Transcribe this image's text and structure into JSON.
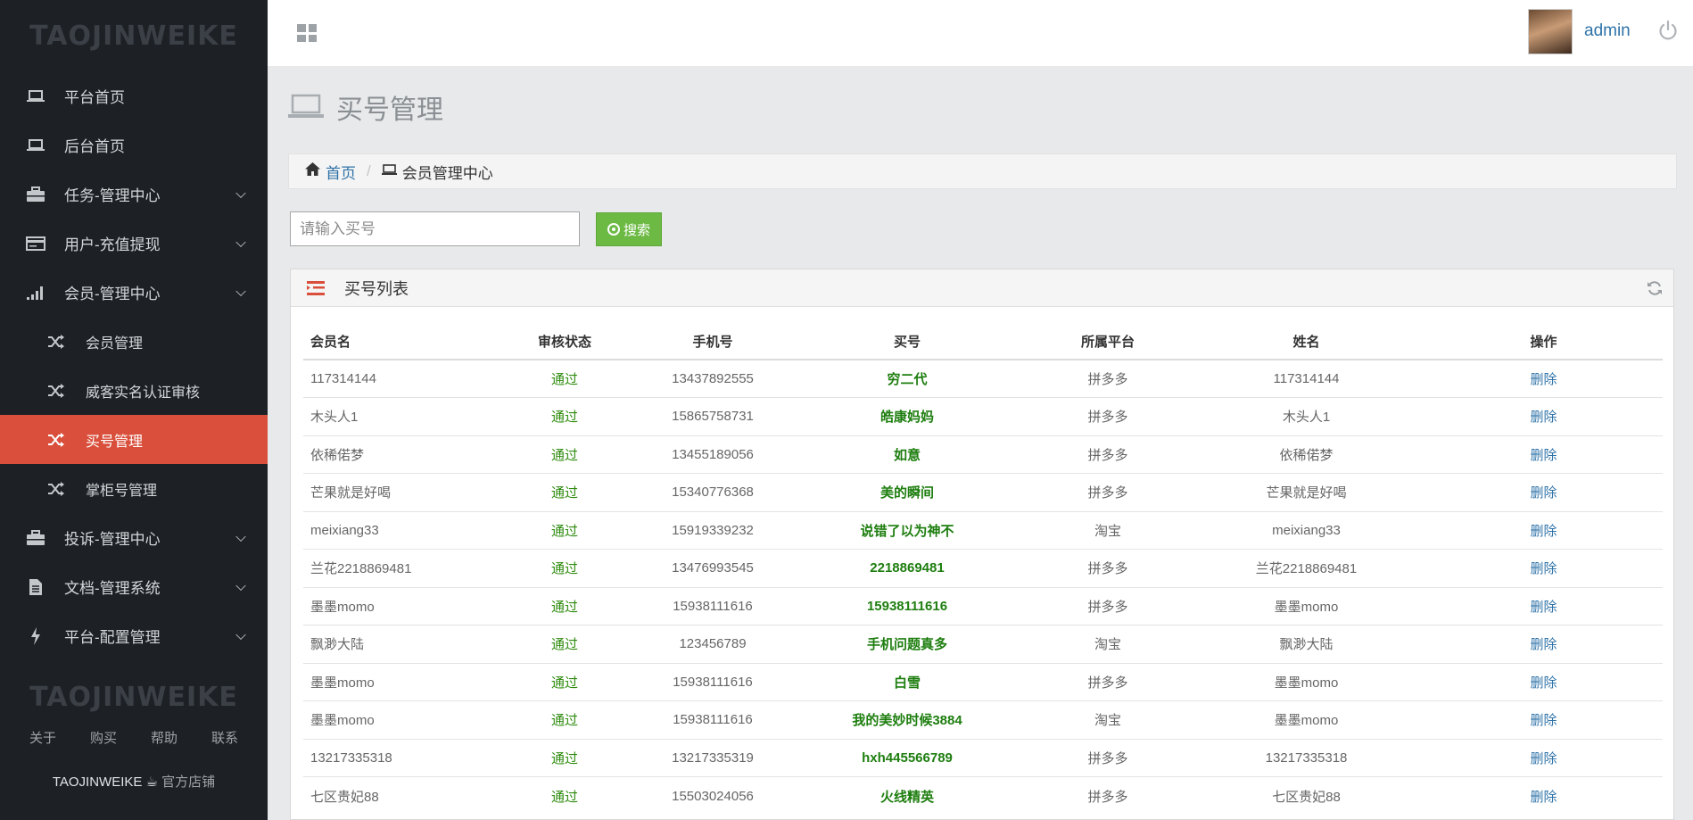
{
  "app": {
    "brand": "TAOJINWEIKE",
    "user": "admin"
  },
  "sidebar": {
    "items": [
      {
        "label": "平台首页",
        "icon": "laptop-icon"
      },
      {
        "label": "后台首页",
        "icon": "laptop-icon"
      },
      {
        "label": "任务-管理中心",
        "icon": "briefcase-icon"
      },
      {
        "label": "用户-充值提现",
        "icon": "card-icon"
      },
      {
        "label": "会员-管理中心",
        "icon": "signal-icon"
      }
    ],
    "subitems": [
      {
        "label": "会员管理"
      },
      {
        "label": "威客实名认证审核"
      },
      {
        "label": "买号管理"
      },
      {
        "label": "掌柜号管理"
      }
    ],
    "items2": [
      {
        "label": "投诉-管理中心",
        "icon": "briefcase-icon"
      },
      {
        "label": "文档-管理系统",
        "icon": "document-icon"
      },
      {
        "label": "平台-配置管理",
        "icon": "bolt-icon"
      }
    ],
    "footer_brand": "TAOJINWEIKE",
    "footer_links": [
      "关于",
      "购买",
      "帮助",
      "联系"
    ],
    "shop_name": "TAOJINWEIKE",
    "shop_label": "官方店铺"
  },
  "page": {
    "title": "买号管理",
    "breadcrumb_home": "首页",
    "breadcrumb_current": "会员管理中心",
    "search_placeholder": "请输入买号",
    "search_button": "搜索",
    "panel_title": "买号列表"
  },
  "table": {
    "headers": [
      "会员名",
      "审核状态",
      "手机号",
      "买号",
      "所属平台",
      "姓名",
      "操作"
    ],
    "rows": [
      {
        "member": "117314144",
        "status": "通过",
        "phone": "13437892555",
        "account": "穷二代",
        "platform": "拼多多",
        "name": "117314144",
        "action": "删除"
      },
      {
        "member": "木头人1",
        "status": "通过",
        "phone": "15865758731",
        "account": "皓康妈妈",
        "platform": "拼多多",
        "name": "木头人1",
        "action": "删除"
      },
      {
        "member": "依稀偌梦",
        "status": "通过",
        "phone": "13455189056",
        "account": "如意",
        "platform": "拼多多",
        "name": "依稀偌梦",
        "action": "删除"
      },
      {
        "member": "芒果就是好喝",
        "status": "通过",
        "phone": "15340776368",
        "account": "美的瞬间",
        "platform": "拼多多",
        "name": "芒果就是好喝",
        "action": "删除"
      },
      {
        "member": "meixiang33",
        "status": "通过",
        "phone": "15919339232",
        "account": "说错了以为神不",
        "platform": "淘宝",
        "name": "meixiang33",
        "action": "删除"
      },
      {
        "member": "兰花2218869481",
        "status": "通过",
        "phone": "13476993545",
        "account": "2218869481",
        "platform": "拼多多",
        "name": "兰花2218869481",
        "action": "删除"
      },
      {
        "member": "墨墨momo",
        "status": "通过",
        "phone": "15938111616",
        "account": "15938111616",
        "platform": "拼多多",
        "name": "墨墨momo",
        "action": "删除"
      },
      {
        "member": "飘渺大陆",
        "status": "通过",
        "phone": "123456789",
        "account": "手机问题真多",
        "platform": "淘宝",
        "name": "飘渺大陆",
        "action": "删除"
      },
      {
        "member": "墨墨momo",
        "status": "通过",
        "phone": "15938111616",
        "account": "白雪",
        "platform": "拼多多",
        "name": "墨墨momo",
        "action": "删除"
      },
      {
        "member": "墨墨momo",
        "status": "通过",
        "phone": "15938111616",
        "account": "我的美妙时候3884",
        "platform": "淘宝",
        "name": "墨墨momo",
        "action": "删除"
      },
      {
        "member": "13217335318",
        "status": "通过",
        "phone": "13217335319",
        "account": "hxh445566789",
        "platform": "拼多多",
        "name": "13217335318",
        "action": "删除"
      },
      {
        "member": "七区贵妃88",
        "status": "通过",
        "phone": "15503024056",
        "account": "火线精英",
        "platform": "拼多多",
        "name": "七区贵妃88",
        "action": "删除"
      }
    ]
  },
  "colors": {
    "sidebar_bg": "#1d2126",
    "active_item": "#d94f3b",
    "status_green": "#2e8b0e",
    "link_blue": "#2f73a8",
    "search_button": "#6cba44"
  }
}
